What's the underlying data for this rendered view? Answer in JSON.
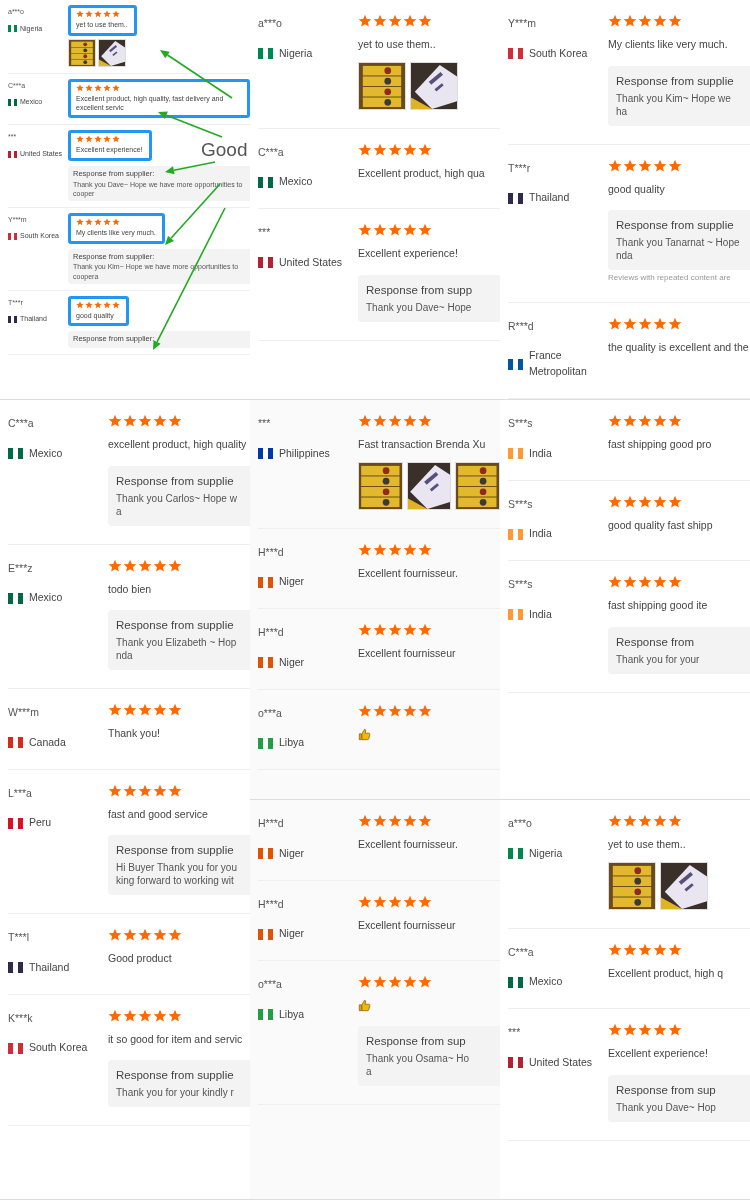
{
  "columns": [
    {
      "panels": [
        {
          "kind": "annotated",
          "annotation": "Good",
          "reviews": [
            {
              "name": "a***o",
              "country": "Nigeria",
              "color": "#008751",
              "stars": 5,
              "kind": "text",
              "highlighted": true,
              "comment": "yet to use them..",
              "photos": [
                {
                  "kind": "picture"
                },
                {
                  "kind": "picture"
                }
              ]
            },
            {
              "name": "C***a",
              "country": "Mexico",
              "color": "#006847",
              "stars": 5,
              "kind": "text",
              "highlighted": true,
              "comment": "Excellent product, high quality, fast delivery and excellent servic"
            },
            {
              "name": "***",
              "country": "United States",
              "color": "#b22234",
              "stars": 5,
              "kind": "text",
              "highlighted": true,
              "comment": "Excellent experience!",
              "response": {
                "title": "Response from supplier:",
                "lines": [
                  "Thank you Dave~ Hope we have more opportunities to cooper"
                ]
              }
            },
            {
              "name": "Y***m",
              "country": "South Korea",
              "color": "#cd2e3a",
              "stars": 5,
              "kind": "text",
              "highlighted": true,
              "comment": "My clients like very much.",
              "response": {
                "title": "Response from supplier:",
                "lines": [
                  "Thank you Kim~ Hope we have more opportunities to coopera"
                ]
              }
            },
            {
              "name": "T***r",
              "country": "Thailand",
              "color": "#2d2a4a",
              "stars": 5,
              "kind": "text",
              "highlighted": true,
              "comment": "good quality",
              "response": {
                "title": "Response from supplier:"
              }
            }
          ]
        },
        {
          "kind": "plain",
          "reviews": [
            {
              "name": "C***a",
              "country": "Mexico",
              "color": "#006847",
              "stars": 5,
              "kind": "text",
              "comment": "excellent product, high quality",
              "response": {
                "title": "Response from supplie",
                "lines": [
                  "Thank you Carlos~ Hope w",
                  "a"
                ]
              }
            },
            {
              "name": "E***z",
              "country": "Mexico",
              "color": "#006847",
              "stars": 5,
              "kind": "text",
              "comment": "todo bien",
              "response": {
                "title": "Response from supplie",
                "lines": [
                  "Thank you Elizabeth ~ Hop",
                  "nda"
                ]
              }
            },
            {
              "name": "W***m",
              "country": "Canada",
              "color": "#d52b1e",
              "stars": 5,
              "kind": "text",
              "comment": "Thank you!"
            },
            {
              "name": "L***a",
              "country": "Peru",
              "color": "#d91023",
              "stars": 5,
              "kind": "text",
              "comment": "fast and good service",
              "response": {
                "title": "Response from supplie",
                "lines": [
                  "Hi Buyer Thank you for you",
                  "king forward to working wit"
                ]
              }
            },
            {
              "name": "T***l",
              "country": "Thailand",
              "color": "#2d2a4a",
              "stars": 5,
              "kind": "text",
              "comment": "Good product"
            },
            {
              "name": "K***k",
              "country": "South Korea",
              "color": "#cd2e3a",
              "stars": 5,
              "kind": "text",
              "comment": "it so good for item and servic",
              "response": {
                "title": "Response from supplie",
                "lines": [
                  "Thank you for your kindly r"
                ]
              }
            }
          ]
        }
      ]
    },
    {
      "panels": [
        {
          "kind": "plain",
          "reviews": [
            {
              "name": "a***o",
              "country": "Nigeria",
              "color": "#008751",
              "stars": 5,
              "kind": "text",
              "comment": "yet to use them..",
              "photos": [
                {
                  "kind": "picture"
                },
                {
                  "kind": "picture"
                }
              ]
            },
            {
              "name": "C***a",
              "country": "Mexico",
              "color": "#006847",
              "stars": 5,
              "kind": "text",
              "comment": "Excellent product, high qua"
            },
            {
              "name": "***",
              "country": "United States",
              "color": "#b22234",
              "stars": 5,
              "kind": "text",
              "comment": "Excellent experience!",
              "response": {
                "title": "Response from supp",
                "lines": [
                  "Thank you Dave~ Hope"
                ]
              }
            }
          ]
        },
        {
          "kind": "plain",
          "reviews": [
            {
              "name": "***",
              "country": "Philippines",
              "color": "#0038a8",
              "stars": 5,
              "kind": "text",
              "comment": "Fast transaction Brenda Xu",
              "photos": [
                {
                  "kind": "picture"
                },
                {
                  "kind": "picture"
                },
                {
                  "kind": "picture"
                }
              ]
            },
            {
              "name": "H***d",
              "country": "Niger",
              "color": "#e05206",
              "stars": 5,
              "kind": "text",
              "comment": "Excellent fournisseur."
            },
            {
              "name": "H***d",
              "country": "Niger",
              "color": "#e05206",
              "stars": 5,
              "kind": "text",
              "comment": "Excellent fournisseur"
            },
            {
              "name": "o***a",
              "country": "Libya",
              "color": "#239e46",
              "stars": 5,
              "kind": "reaction"
            }
          ]
        },
        {
          "kind": "plain",
          "reviews": [
            {
              "name": "H***d",
              "country": "Niger",
              "color": "#e05206",
              "stars": 5,
              "kind": "text",
              "comment": "Excellent fournisseur."
            },
            {
              "name": "H***d",
              "country": "Niger",
              "color": "#e05206",
              "stars": 5,
              "kind": "text",
              "comment": "Excellent fournisseur"
            },
            {
              "name": "o***a",
              "country": "Libya",
              "color": "#239e46",
              "stars": 5,
              "kind": "reaction",
              "response": {
                "title": "Response from sup",
                "lines": [
                  "Thank you Osama~ Ho",
                  "a"
                ]
              }
            }
          ]
        }
      ]
    },
    {
      "panels": [
        {
          "kind": "plain",
          "reviews": [
            {
              "name": "Y***m",
              "country": "South Korea",
              "color": "#cd2e3a",
              "stars": 5,
              "kind": "text",
              "comment": "My clients like very much.",
              "response": {
                "title": "Response from supplie",
                "lines": [
                  "Thank you Kim~ Hope we ha"
                ]
              }
            },
            {
              "name": "T***r",
              "country": "Thailand",
              "color": "#2d2a4a",
              "stars": 5,
              "kind": "text",
              "comment": "good quality",
              "response": {
                "title": "Response from supplie",
                "lines": [
                  "Thank you Tanarnat ~ Hope",
                  "nda"
                ]
              },
              "note": "Reviews with repeated content are"
            },
            {
              "name": "R***d",
              "country": "France Metropolitan",
              "color": "#0055a4",
              "stars": 5,
              "kind": "text",
              "comment": "the quality is excellent and the"
            }
          ]
        },
        {
          "kind": "plain",
          "reviews": [
            {
              "name": "S***s",
              "country": "India",
              "color": "#ff9933",
              "stars": 5,
              "kind": "text",
              "comment": "fast shipping good pro"
            },
            {
              "name": "S***s",
              "country": "India",
              "color": "#ff9933",
              "stars": 5,
              "kind": "text",
              "comment": "good quality fast shipp"
            },
            {
              "name": "S***s",
              "country": "India",
              "color": "#ff9933",
              "stars": 5,
              "kind": "text",
              "comment": "fast shipping good ite",
              "response": {
                "title": "Response from",
                "lines": [
                  "Thank you for your"
                ]
              }
            }
          ]
        },
        {
          "kind": "plain",
          "reviews": [
            {
              "name": "a***o",
              "country": "Nigeria",
              "color": "#008751",
              "stars": 5,
              "kind": "text",
              "comment": "yet to use them..",
              "photos": [
                {
                  "kind": "picture"
                },
                {
                  "kind": "picture"
                }
              ]
            },
            {
              "name": "C***a",
              "country": "Mexico",
              "color": "#006847",
              "stars": 5,
              "kind": "text",
              "comment": "Excellent product, high q"
            },
            {
              "name": "***",
              "country": "United States",
              "color": "#b22234",
              "stars": 5,
              "kind": "text",
              "comment": "Excellent experience!",
              "response": {
                "title": "Response from sup",
                "lines": [
                  "Thank you Dave~ Hop"
                ]
              }
            }
          ]
        }
      ]
    }
  ]
}
